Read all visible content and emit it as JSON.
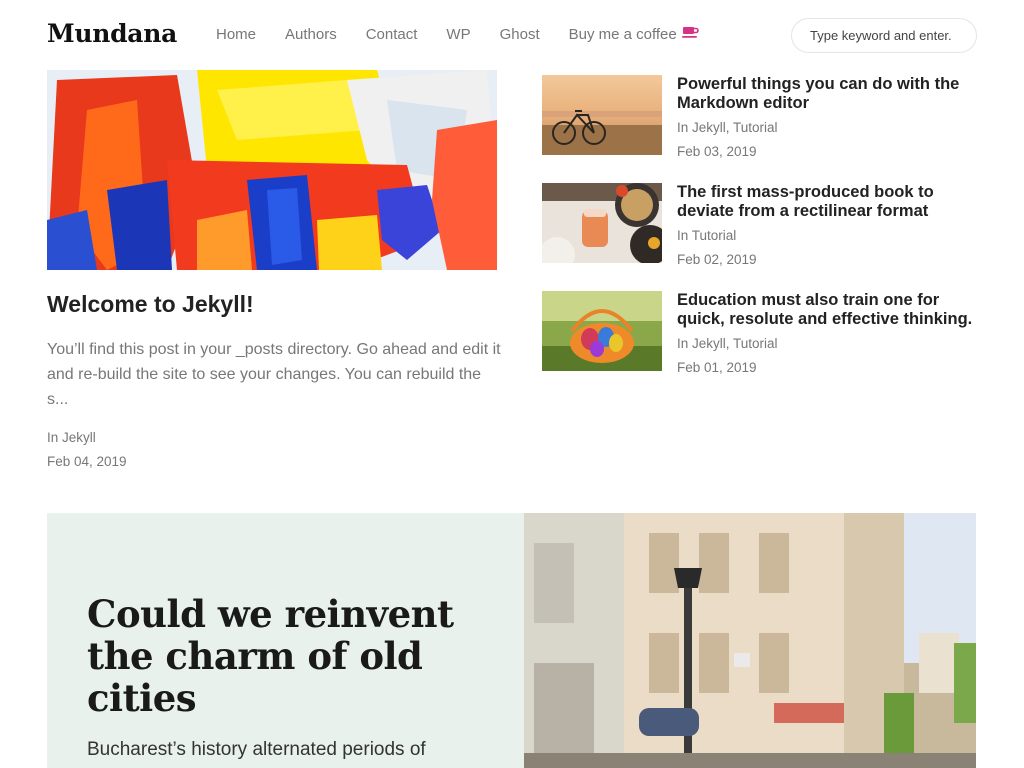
{
  "brand": "Mundana",
  "nav": {
    "items": [
      "Home",
      "Authors",
      "Contact",
      "WP",
      "Ghost"
    ],
    "coffee_label": "Buy me a coffee",
    "coffee_icon": "coffee-cup-icon",
    "accent": "#d63384"
  },
  "search": {
    "placeholder": "Type keyword and enter."
  },
  "featured": {
    "title": "Welcome to Jekyll!",
    "excerpt": "You’ll find this post in your _posts directory. Go ahead and edit it and re-build the site to see your changes. You can rebuild the s...",
    "category": "In Jekyll",
    "date": "Feb 04, 2019"
  },
  "side_posts": [
    {
      "title": "Powerful things you can do with the Markdown editor",
      "cats": [
        "Jekyll",
        "Tutorial"
      ],
      "cat_prefix": "In ",
      "date": "Feb 03, 2019"
    },
    {
      "title": "The first mass-produced book to deviate from a rectilinear format",
      "cats": [
        "Tutorial"
      ],
      "cat_prefix": "In ",
      "date": "Feb 02, 2019"
    },
    {
      "title": "Education must also train one for quick, resolute and effective thinking.",
      "cats": [
        "Jekyll",
        "Tutorial"
      ],
      "cat_prefix": "In ",
      "date": "Feb 01, 2019"
    }
  ],
  "jumbotron": {
    "title": "Could we reinvent the charm of old cities",
    "text": "Bucharest’s history alternated periods of",
    "background": "#e9f1ec"
  }
}
